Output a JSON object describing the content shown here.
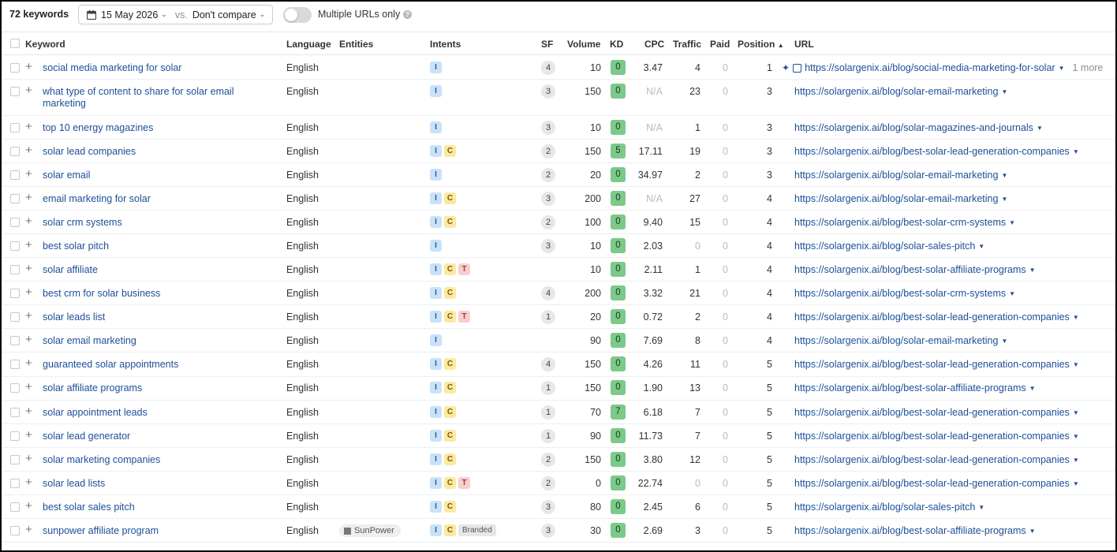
{
  "toolbar": {
    "keyword_count": "72 keywords",
    "date": "15 May 2026",
    "vs_label": "vs.",
    "compare": "Don't compare",
    "multiple_urls_label": "Multiple URLs only",
    "multiple_urls_on": false
  },
  "columns": {
    "keyword": "Keyword",
    "language": "Language",
    "entities": "Entities",
    "intents": "Intents",
    "sf": "SF",
    "volume": "Volume",
    "kd": "KD",
    "cpc": "CPC",
    "traffic": "Traffic",
    "paid": "Paid",
    "position": "Position",
    "url": "URL"
  },
  "sort": {
    "column": "position",
    "direction": "asc"
  },
  "first_row_more": "1 more",
  "rows": [
    {
      "keyword": "social media marketing for solar",
      "language": "English",
      "entity": "",
      "intents": [
        "I"
      ],
      "sf": "4",
      "volume": "10",
      "kd": "0",
      "cpc": "3.47",
      "traffic": "4",
      "paid": "0",
      "position": "1",
      "url": "https://solargenix.ai/blog/social-media-marketing-for-solar"
    },
    {
      "keyword": "what type of content to share for solar email marketing",
      "language": "English",
      "entity": "",
      "intents": [
        "I"
      ],
      "sf": "3",
      "volume": "150",
      "kd": "0",
      "cpc": "N/A",
      "traffic": "23",
      "paid": "0",
      "position": "3",
      "url": "https://solargenix.ai/blog/solar-email-marketing"
    },
    {
      "keyword": "top 10 energy magazines",
      "language": "English",
      "entity": "",
      "intents": [
        "I"
      ],
      "sf": "3",
      "volume": "10",
      "kd": "0",
      "cpc": "N/A",
      "traffic": "1",
      "paid": "0",
      "position": "3",
      "url": "https://solargenix.ai/blog/solar-magazines-and-journals"
    },
    {
      "keyword": "solar lead companies",
      "language": "English",
      "entity": "",
      "intents": [
        "I",
        "C"
      ],
      "sf": "2",
      "volume": "150",
      "kd": "5",
      "cpc": "17.11",
      "traffic": "19",
      "paid": "0",
      "position": "3",
      "url": "https://solargenix.ai/blog/best-solar-lead-generation-companies"
    },
    {
      "keyword": "solar email",
      "language": "English",
      "entity": "",
      "intents": [
        "I"
      ],
      "sf": "2",
      "volume": "20",
      "kd": "0",
      "cpc": "34.97",
      "traffic": "2",
      "paid": "0",
      "position": "3",
      "url": "https://solargenix.ai/blog/solar-email-marketing"
    },
    {
      "keyword": "email marketing for solar",
      "language": "English",
      "entity": "",
      "intents": [
        "I",
        "C"
      ],
      "sf": "3",
      "volume": "200",
      "kd": "0",
      "cpc": "N/A",
      "traffic": "27",
      "paid": "0",
      "position": "4",
      "url": "https://solargenix.ai/blog/solar-email-marketing"
    },
    {
      "keyword": "solar crm systems",
      "language": "English",
      "entity": "",
      "intents": [
        "I",
        "C"
      ],
      "sf": "2",
      "volume": "100",
      "kd": "0",
      "cpc": "9.40",
      "traffic": "15",
      "paid": "0",
      "position": "4",
      "url": "https://solargenix.ai/blog/best-solar-crm-systems"
    },
    {
      "keyword": "best solar pitch",
      "language": "English",
      "entity": "",
      "intents": [
        "I"
      ],
      "sf": "3",
      "volume": "10",
      "kd": "0",
      "cpc": "2.03",
      "traffic": "0",
      "paid": "0",
      "position": "4",
      "url": "https://solargenix.ai/blog/solar-sales-pitch"
    },
    {
      "keyword": "solar affiliate",
      "language": "English",
      "entity": "",
      "intents": [
        "I",
        "C",
        "T"
      ],
      "sf": "",
      "volume": "10",
      "kd": "0",
      "cpc": "2.11",
      "traffic": "1",
      "paid": "0",
      "position": "4",
      "url": "https://solargenix.ai/blog/best-solar-affiliate-programs"
    },
    {
      "keyword": "best crm for solar business",
      "language": "English",
      "entity": "",
      "intents": [
        "I",
        "C"
      ],
      "sf": "4",
      "volume": "200",
      "kd": "0",
      "cpc": "3.32",
      "traffic": "21",
      "paid": "0",
      "position": "4",
      "url": "https://solargenix.ai/blog/best-solar-crm-systems"
    },
    {
      "keyword": "solar leads list",
      "language": "English",
      "entity": "",
      "intents": [
        "I",
        "C",
        "T"
      ],
      "sf": "1",
      "volume": "20",
      "kd": "0",
      "cpc": "0.72",
      "traffic": "2",
      "paid": "0",
      "position": "4",
      "url": "https://solargenix.ai/blog/best-solar-lead-generation-companies"
    },
    {
      "keyword": "solar email marketing",
      "language": "English",
      "entity": "",
      "intents": [
        "I"
      ],
      "sf": "",
      "volume": "90",
      "kd": "0",
      "cpc": "7.69",
      "traffic": "8",
      "paid": "0",
      "position": "4",
      "url": "https://solargenix.ai/blog/solar-email-marketing"
    },
    {
      "keyword": "guaranteed solar appointments",
      "language": "English",
      "entity": "",
      "intents": [
        "I",
        "C"
      ],
      "sf": "4",
      "volume": "150",
      "kd": "0",
      "cpc": "4.26",
      "traffic": "11",
      "paid": "0",
      "position": "5",
      "url": "https://solargenix.ai/blog/best-solar-lead-generation-companies"
    },
    {
      "keyword": "solar affiliate programs",
      "language": "English",
      "entity": "",
      "intents": [
        "I",
        "C"
      ],
      "sf": "1",
      "volume": "150",
      "kd": "0",
      "cpc": "1.90",
      "traffic": "13",
      "paid": "0",
      "position": "5",
      "url": "https://solargenix.ai/blog/best-solar-affiliate-programs"
    },
    {
      "keyword": "solar appointment leads",
      "language": "English",
      "entity": "",
      "intents": [
        "I",
        "C"
      ],
      "sf": "1",
      "volume": "70",
      "kd": "7",
      "cpc": "6.18",
      "traffic": "7",
      "paid": "0",
      "position": "5",
      "url": "https://solargenix.ai/blog/best-solar-lead-generation-companies"
    },
    {
      "keyword": "solar lead generator",
      "language": "English",
      "entity": "",
      "intents": [
        "I",
        "C"
      ],
      "sf": "1",
      "volume": "90",
      "kd": "0",
      "cpc": "11.73",
      "traffic": "7",
      "paid": "0",
      "position": "5",
      "url": "https://solargenix.ai/blog/best-solar-lead-generation-companies"
    },
    {
      "keyword": "solar marketing companies",
      "language": "English",
      "entity": "",
      "intents": [
        "I",
        "C"
      ],
      "sf": "2",
      "volume": "150",
      "kd": "0",
      "cpc": "3.80",
      "traffic": "12",
      "paid": "0",
      "position": "5",
      "url": "https://solargenix.ai/blog/best-solar-lead-generation-companies"
    },
    {
      "keyword": "solar lead lists",
      "language": "English",
      "entity": "",
      "intents": [
        "I",
        "C",
        "T"
      ],
      "sf": "2",
      "volume": "0",
      "kd": "0",
      "cpc": "22.74",
      "traffic": "0",
      "paid": "0",
      "position": "5",
      "url": "https://solargenix.ai/blog/best-solar-lead-generation-companies"
    },
    {
      "keyword": "best solar sales pitch",
      "language": "English",
      "entity": "",
      "intents": [
        "I",
        "C"
      ],
      "sf": "3",
      "volume": "80",
      "kd": "0",
      "cpc": "2.45",
      "traffic": "6",
      "paid": "0",
      "position": "5",
      "url": "https://solargenix.ai/blog/solar-sales-pitch"
    },
    {
      "keyword": "sunpower affiliate program",
      "language": "English",
      "entity": "SunPower",
      "intents": [
        "I",
        "C",
        "Branded"
      ],
      "sf": "3",
      "volume": "30",
      "kd": "0",
      "cpc": "2.69",
      "traffic": "3",
      "paid": "0",
      "position": "5",
      "url": "https://solargenix.ai/blog/best-solar-affiliate-programs"
    }
  ],
  "colors": {
    "link": "#1c4f98",
    "kd_easy": "#7cc98a",
    "intent_informational": "#c9e2fa",
    "intent_commercial": "#fbe9a0",
    "intent_transactional": "#f7cfcf"
  }
}
